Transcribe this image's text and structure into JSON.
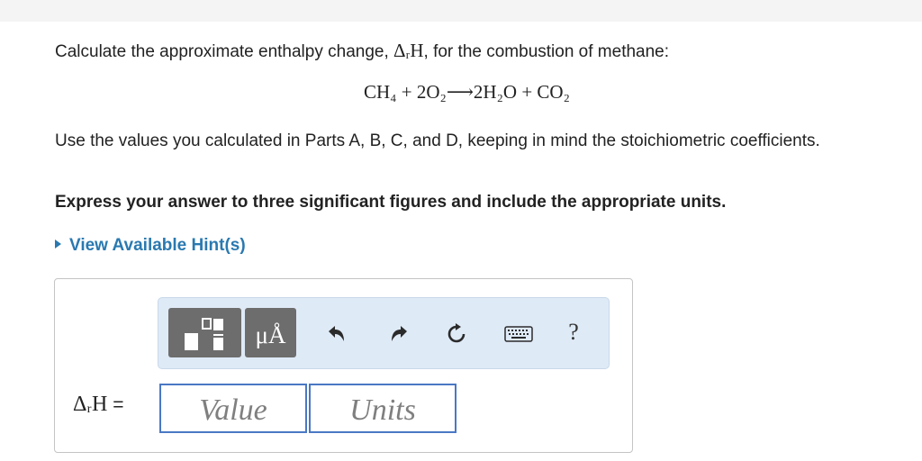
{
  "question": {
    "prefix": "Calculate the approximate enthalpy change, ",
    "symbol": "ΔᵣH",
    "suffix": ", for the combustion of methane:",
    "equation": "CH₄ + 2O₂⟶2H₂O + CO₂"
  },
  "instructions": "Use the values you calculated in Parts A, B, C, and D, keeping in mind the stoichiometric coefficients.",
  "emphasis": "Express your answer to three significant figures and include the appropriate units.",
  "hint_link": "View Available Hint(s)",
  "toolbar": {
    "mu_label": "μÅ",
    "help_label": "?",
    "icons": [
      "templates-icon",
      "units-mu-icon",
      "undo-icon",
      "redo-icon",
      "reset-icon",
      "keyboard-icon",
      "help-icon"
    ]
  },
  "answer": {
    "label_symbol": "ΔᵣH",
    "label_equals": "=",
    "value_placeholder": "Value",
    "units_placeholder": "Units"
  },
  "colors": {
    "link": "#2a79b0",
    "toolbar_bg": "#dfeaf7",
    "button_gray": "#6d6d6d",
    "field_border": "#4a78c4"
  }
}
